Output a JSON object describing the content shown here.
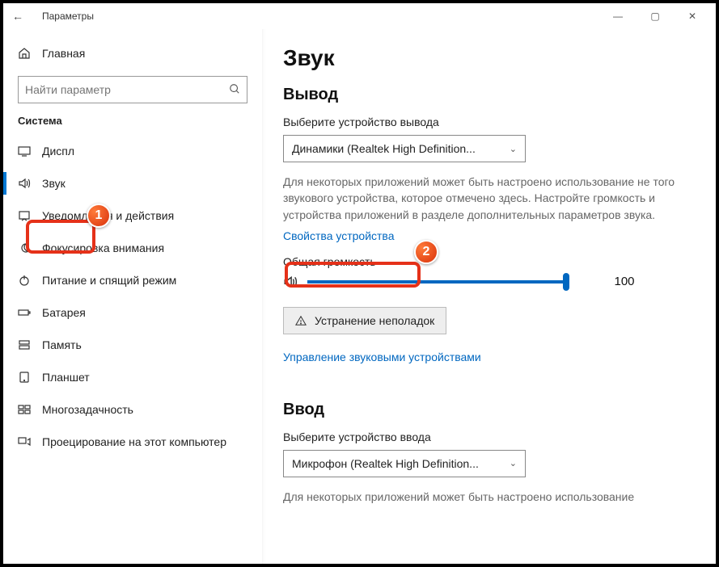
{
  "window": {
    "title": "Параметры"
  },
  "sidebar": {
    "home": "Главная",
    "search_placeholder": "Найти параметр",
    "category": "Система",
    "items": [
      {
        "icon": "display",
        "label": "Дисплей",
        "truncated": "Диспл"
      },
      {
        "icon": "sound",
        "label": "Звук",
        "active": true
      },
      {
        "icon": "notify",
        "label": "Уведомления и действия"
      },
      {
        "icon": "focus",
        "label": "Фокусировка внимания"
      },
      {
        "icon": "power",
        "label": "Питание и спящий режим"
      },
      {
        "icon": "battery",
        "label": "Батарея"
      },
      {
        "icon": "storage",
        "label": "Память"
      },
      {
        "icon": "tablet",
        "label": "Планшет"
      },
      {
        "icon": "multitask",
        "label": "Многозадачность"
      },
      {
        "icon": "project",
        "label": "Проецирование на этот компьютер"
      }
    ]
  },
  "main": {
    "page_title": "Звук",
    "output": {
      "heading": "Вывод",
      "choose_label": "Выберите устройство вывода",
      "device": "Динамики (Realtek High Definition...",
      "description": "Для некоторых приложений может быть настроено использование не того звукового устройства, которое отмечено здесь. Настройте громкость и устройства приложений в разделе дополнительных параметров звука.",
      "properties_link": "Свойства устройства",
      "volume_label": "Общая громкость",
      "volume_value": "100",
      "troubleshoot": "Устранение неполадок",
      "manage_link": "Управление звуковыми устройствами"
    },
    "input": {
      "heading": "Ввод",
      "choose_label": "Выберите устройство ввода",
      "device": "Микрофон (Realtek High Definition...",
      "description": "Для некоторых приложений может быть настроено использование"
    }
  },
  "callouts": {
    "one": "1",
    "two": "2"
  }
}
